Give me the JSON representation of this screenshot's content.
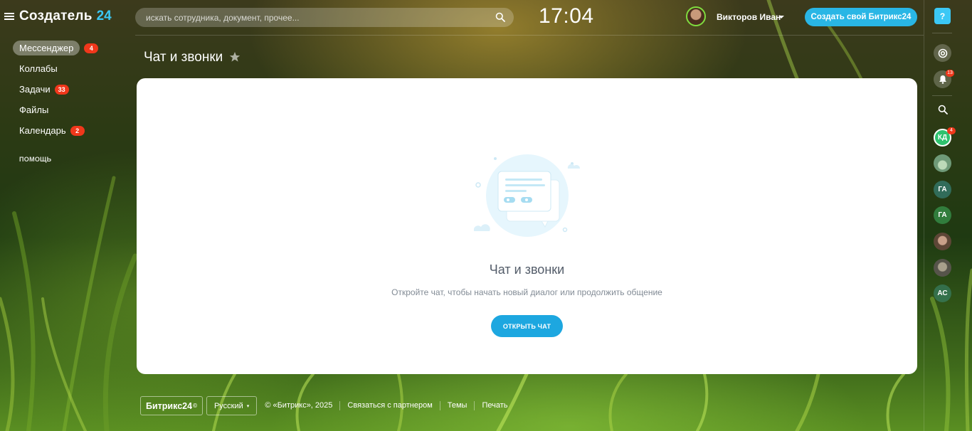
{
  "logo": {
    "name": "Создатель",
    "number": "24"
  },
  "sidebar": {
    "items": [
      {
        "label": "Мессенджер",
        "badge": "4"
      },
      {
        "label": "Коллабы",
        "badge": ""
      },
      {
        "label": "Задачи",
        "badge": "33"
      },
      {
        "label": "Файлы",
        "badge": ""
      },
      {
        "label": "Календарь",
        "badge": "2"
      }
    ],
    "help_label": "ПОМОЩЬ"
  },
  "header": {
    "search_placeholder": "искать сотрудника, документ, прочее...",
    "clock": "17:04",
    "user_name": "Викторов Иван",
    "create_button": "Создать свой Битрикс24"
  },
  "page": {
    "title": "Чат и звонки"
  },
  "card": {
    "title": "Чат и звонки",
    "subtitle": "Откройте чат, чтобы начать новый диалог или продолжить общение",
    "button": "ОТКРЫТЬ ЧАТ"
  },
  "footer": {
    "logo": "Битрикс24",
    "language": "Русский",
    "copyright": "© «Битрикс», 2025",
    "links": [
      "Связаться с партнером",
      "Темы",
      "Печать"
    ]
  },
  "right_bar": {
    "help": "?",
    "notifications_badge": "13",
    "kd_label": "КД",
    "kd_badge": "4",
    "contacts": [
      "ГА",
      "ГА",
      "АС"
    ]
  },
  "colors": {
    "accent": "#3bc8f5",
    "badge": "#f0371b",
    "primary_button": "#1da7e0"
  }
}
